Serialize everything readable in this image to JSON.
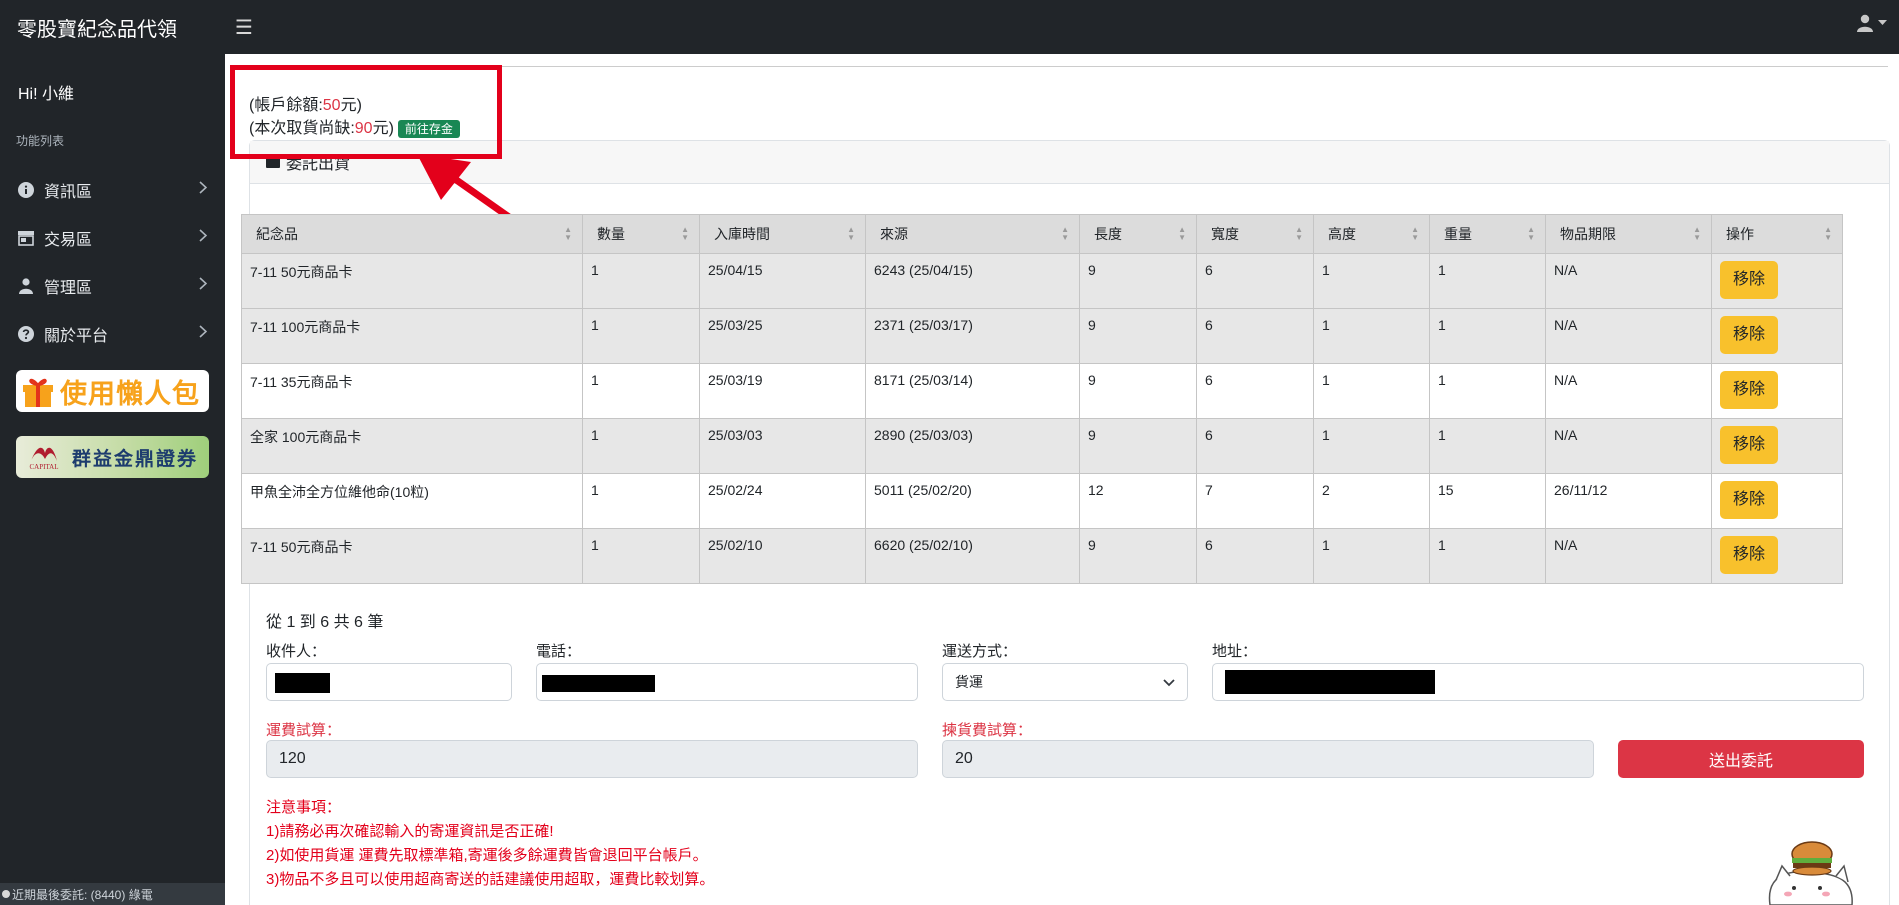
{
  "app": {
    "title": "零股寶紀念品代領"
  },
  "sidebar": {
    "greeting": "Hi! 小維",
    "menu_heading": "功能列表",
    "items": [
      {
        "label": "資訊區",
        "icon": "info-circle-icon"
      },
      {
        "label": "交易區",
        "icon": "store-icon"
      },
      {
        "label": "管理區",
        "icon": "user-icon"
      },
      {
        "label": "關於平台",
        "icon": "question-circle-icon"
      }
    ],
    "banner1_text": "使用懶人包",
    "banner2_brand": "CAPITAL",
    "banner2_text": "群益金鼎證券",
    "footer_status": "近期最後委託: (8440) 綠電"
  },
  "account": {
    "balance_prefix": "(帳戶餘額:",
    "balance_value": "50",
    "balance_suffix": "元)",
    "shortage_prefix": "(本次取貨尚缺:",
    "shortage_value": "90",
    "shortage_suffix": "元)",
    "deposit_button": "前往存金"
  },
  "card": {
    "title": "委託出貨"
  },
  "table": {
    "headers": [
      "紀念品",
      "數量",
      "入庫時間",
      "來源",
      "長度",
      "寬度",
      "高度",
      "重量",
      "物品期限",
      "操作"
    ],
    "rows": [
      [
        "7-11 50元商品卡",
        "1",
        "25/04/15",
        "6243 (25/04/15)",
        "9",
        "6",
        "1",
        "1",
        "N/A"
      ],
      [
        "7-11 100元商品卡",
        "1",
        "25/03/25",
        "2371 (25/03/17)",
        "9",
        "6",
        "1",
        "1",
        "N/A"
      ],
      [
        "7-11 35元商品卡",
        "1",
        "25/03/19",
        "8171 (25/03/14)",
        "9",
        "6",
        "1",
        "1",
        "N/A"
      ],
      [
        "全家 100元商品卡",
        "1",
        "25/03/03",
        "2890 (25/03/03)",
        "9",
        "6",
        "1",
        "1",
        "N/A"
      ],
      [
        "甲魚全沛全方位維他命(10粒)",
        "1",
        "25/02/24",
        "5011 (25/02/20)",
        "12",
        "7",
        "2",
        "15",
        "26/11/12"
      ],
      [
        "7-11 50元商品卡",
        "1",
        "25/02/10",
        "6620 (25/02/10)",
        "9",
        "6",
        "1",
        "1",
        "N/A"
      ]
    ],
    "remove_label": "移除"
  },
  "pagination": {
    "summary": "從 1 到 6 共 6 筆"
  },
  "form": {
    "recipient_label": "收件人：",
    "phone_label": "電話：",
    "shipping_label": "運送方式：",
    "shipping_value": "貨運",
    "address_label": "地址：",
    "freight_label": "運費試算：",
    "freight_value": "120",
    "picking_label": "揀貨費試算：",
    "picking_value": "20",
    "submit_label": "送出委託"
  },
  "notes": {
    "title": "注意事項：",
    "lines": [
      "1)請務必再次確認輸入的寄運資訊是否正確!",
      "2)如使用貨運 運費先取標準箱,寄運後多餘運費皆會退回平台帳戶。",
      "3)物品不多且可以使用超商寄送的話建議使用超取，運費比較划算。"
    ]
  },
  "colors": {
    "navbar": "#212529",
    "danger": "#dc3545",
    "warning": "#f8c12c",
    "success": "#198754",
    "annotation": "#e3001b"
  }
}
